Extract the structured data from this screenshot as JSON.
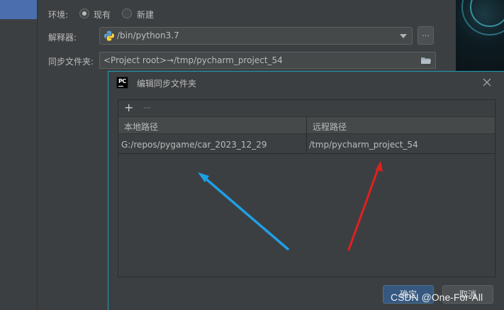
{
  "settings": {
    "environment_label": "环境:",
    "radio_existing": "现有",
    "radio_new": "新建",
    "interpreter_label": "解释器:",
    "interpreter_value": "/bin/python3.7",
    "browse_label": "...",
    "sync_folder_label": "同步文件夹:",
    "sync_folder_value": "<Project root>→/tmp/pycharm_project_54"
  },
  "dialog": {
    "title": "编辑同步文件夹",
    "toolbar": {
      "add": "+",
      "remove": "−"
    },
    "columns": [
      "本地路径",
      "远程路径"
    ],
    "rows": [
      {
        "local": "G:/repos/pygame/car_2023_12_29",
        "remote": "/tmp/pycharm_project_54"
      }
    ],
    "ok_label": "确定",
    "cancel_label": "取消"
  },
  "colors": {
    "arrow_blue": "#1ea0e6",
    "arrow_red": "#e02020",
    "dialog_border": "#1e9bb3",
    "ok_button": "#365880"
  },
  "watermark": "CSDN @One-For-All"
}
